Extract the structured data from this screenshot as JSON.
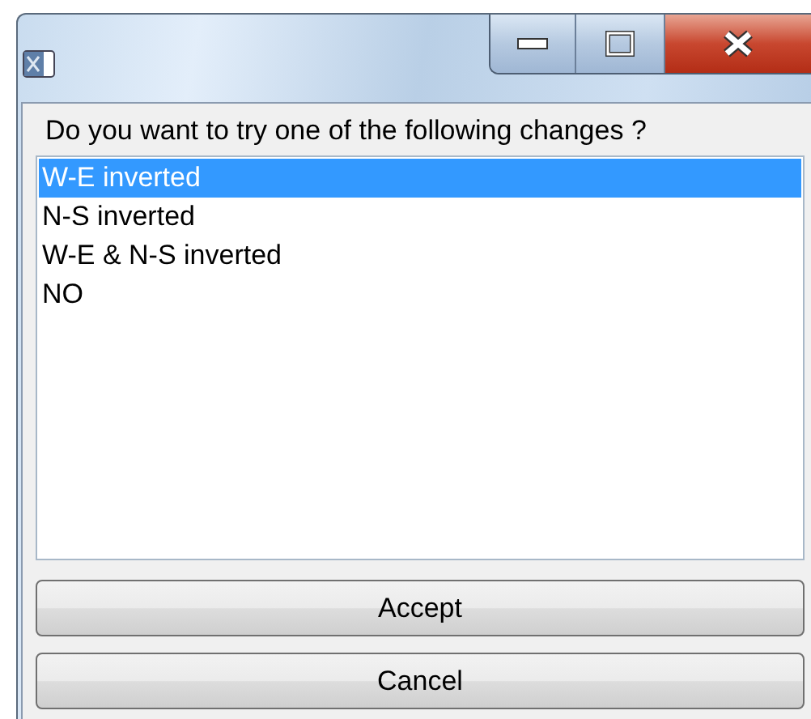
{
  "window": {
    "title_bar": {
      "controls": [
        {
          "kind": "minimize"
        },
        {
          "kind": "maximize"
        },
        {
          "kind": "close"
        }
      ]
    }
  },
  "prompt": "Do you want to try one of the following changes ?",
  "options": [
    {
      "label": "W-E inverted",
      "selected": true
    },
    {
      "label": "N-S inverted",
      "selected": false
    },
    {
      "label": "W-E & N-S inverted",
      "selected": false
    },
    {
      "label": "NO",
      "selected": false
    }
  ],
  "buttons": [
    {
      "label": "Accept"
    },
    {
      "label": "Cancel"
    }
  ]
}
